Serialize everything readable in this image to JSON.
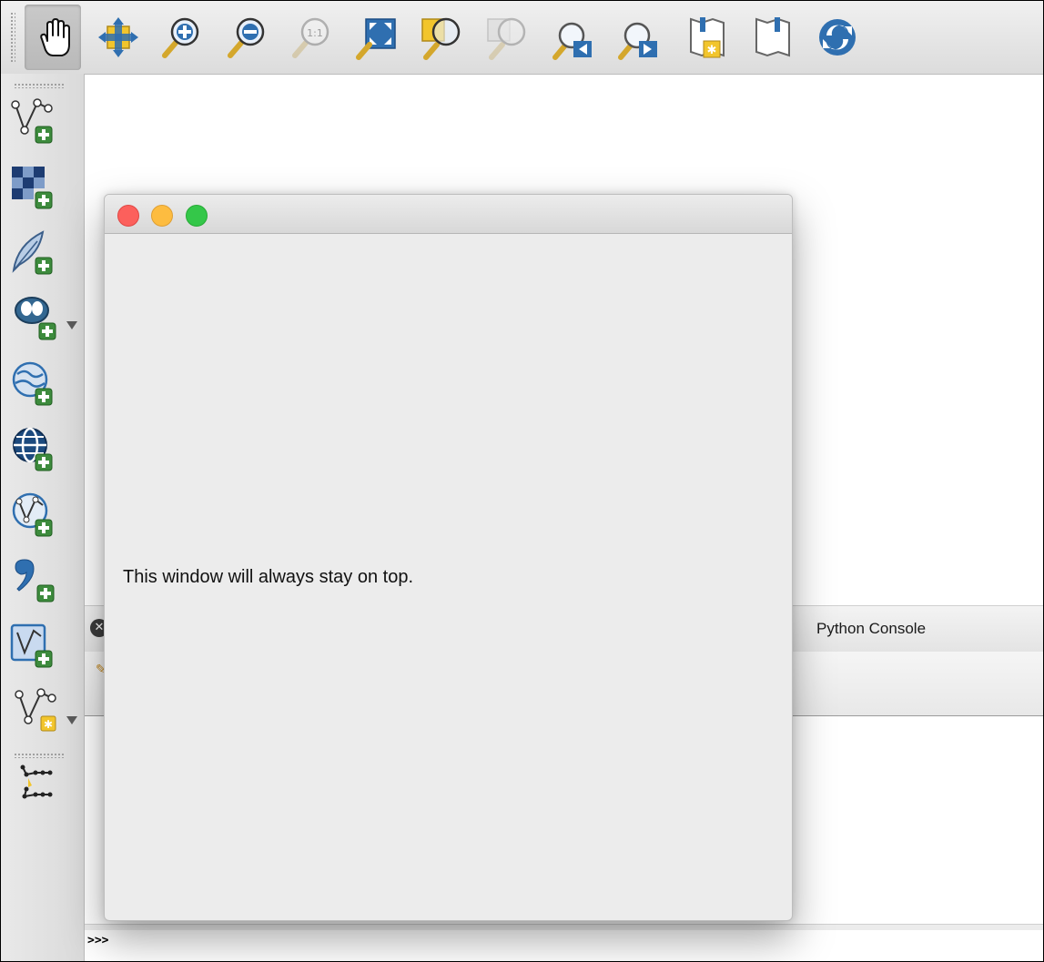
{
  "top_toolbar": {
    "buttons": [
      {
        "icon": "pan-hand-icon",
        "state": "pressed"
      },
      {
        "icon": "pan-to-selection-icon"
      },
      {
        "icon": "zoom-in-icon"
      },
      {
        "icon": "zoom-out-icon"
      },
      {
        "icon": "zoom-native-resolution-icon",
        "label": "1:1"
      },
      {
        "icon": "zoom-full-icon"
      },
      {
        "icon": "zoom-to-selection-icon"
      },
      {
        "icon": "zoom-to-layer-icon"
      },
      {
        "icon": "zoom-last-icon"
      },
      {
        "icon": "zoom-next-icon"
      },
      {
        "icon": "new-map-view-icon"
      },
      {
        "icon": "new-bookmark-icon"
      },
      {
        "icon": "refresh-icon"
      }
    ]
  },
  "left_toolbar": {
    "buttons": [
      {
        "icon": "add-vector-layer-icon"
      },
      {
        "icon": "add-raster-layer-icon"
      },
      {
        "icon": "add-spatialite-layer-icon"
      },
      {
        "icon": "add-postgis-layer-icon",
        "dropdown": true
      },
      {
        "icon": "add-wms-layer-icon"
      },
      {
        "icon": "add-wcs-layer-icon"
      },
      {
        "icon": "add-wfs-layer-icon"
      },
      {
        "icon": "add-delimited-text-layer-icon"
      },
      {
        "icon": "add-virtual-layer-icon"
      },
      {
        "icon": "new-vector-layer-icon",
        "dropdown": true
      },
      {
        "icon": "digitize-edit-icon"
      }
    ]
  },
  "dock": {
    "title": "Python Console",
    "close_glyph": "✕",
    "prompt": ">>>",
    "input_value": ""
  },
  "window": {
    "message": "This window will always stay on top.",
    "controls": [
      "close",
      "minimize",
      "zoom"
    ]
  },
  "colors": {
    "traffic_close": "#fc605c",
    "traffic_minimize": "#fdbc40",
    "traffic_zoom": "#34c749",
    "icon_blue": "#2f6fb0",
    "icon_yellow": "#f2c52c",
    "icon_green": "#3d8b3d"
  }
}
